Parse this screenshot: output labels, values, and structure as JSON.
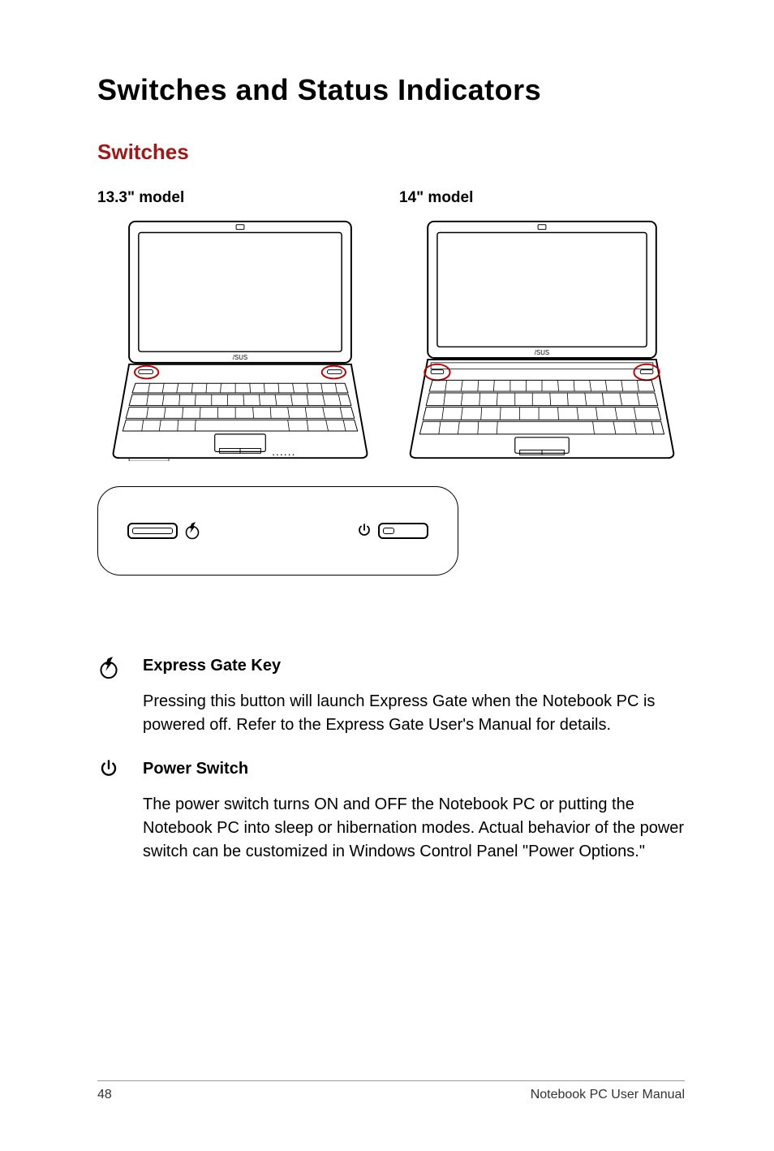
{
  "title": "Switches and Status Indicators",
  "section": "Switches",
  "models": {
    "left_label": "13.3\" model",
    "right_label": "14\" model"
  },
  "switch_panel": {
    "left_icon": "express-gate-icon",
    "right_icon": "power-icon"
  },
  "features": [
    {
      "icon": "express-gate-icon",
      "title": "Express Gate Key",
      "text": "Pressing this button will launch Express Gate when the Notebook PC is powered off. Refer to the Express Gate User's Manual for details."
    },
    {
      "icon": "power-icon",
      "title": "Power Switch",
      "text": "The power switch turns ON and OFF the Notebook PC or putting the Notebook PC into sleep or hibernation modes. Actual behavior of the power switch can be customized in Windows Control Panel \"Power Options.\""
    }
  ],
  "footer": {
    "page": "48",
    "label": "Notebook PC User Manual"
  }
}
